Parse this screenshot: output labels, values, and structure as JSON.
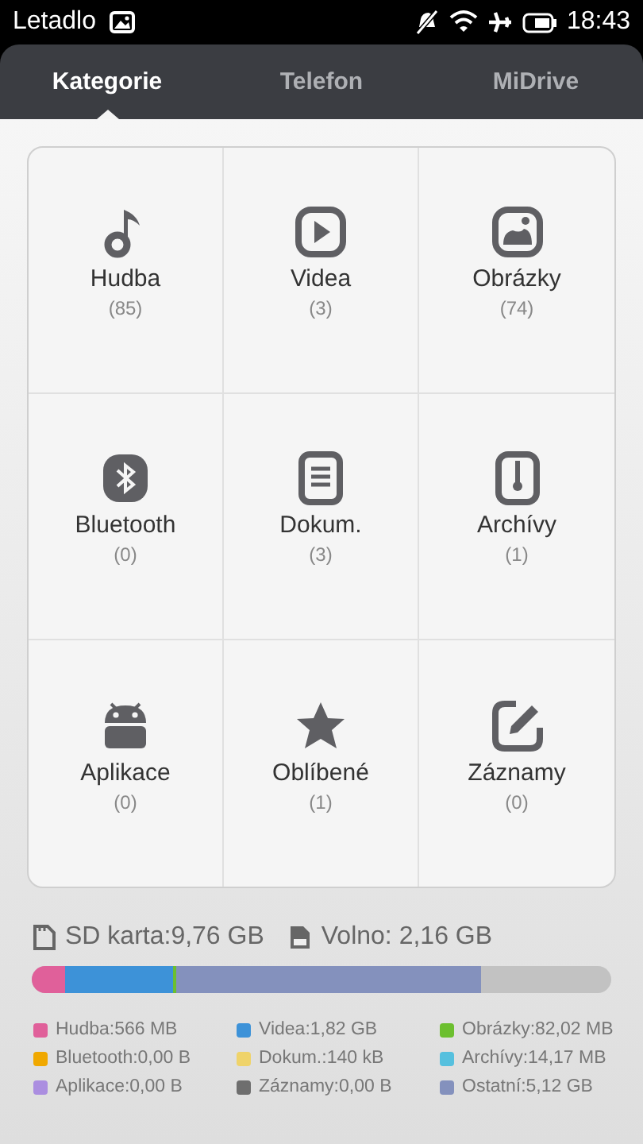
{
  "status_bar": {
    "carrier": "Letadlo",
    "time": "18:43"
  },
  "tabs": [
    {
      "label": "Kategorie",
      "selected": true
    },
    {
      "label": "Telefon",
      "selected": false
    },
    {
      "label": "MiDrive",
      "selected": false
    }
  ],
  "categories": [
    {
      "kind": "music",
      "label": "Hudba",
      "count": "(85)"
    },
    {
      "kind": "video",
      "label": "Videa",
      "count": "(3)"
    },
    {
      "kind": "image",
      "label": "Obrázky",
      "count": "(74)"
    },
    {
      "kind": "bluetooth",
      "label": "Bluetooth",
      "count": "(0)"
    },
    {
      "kind": "document",
      "label": "Dokum.",
      "count": "(3)"
    },
    {
      "kind": "archive",
      "label": "Archívy",
      "count": "(1)"
    },
    {
      "kind": "android",
      "label": "Aplikace",
      "count": "(0)"
    },
    {
      "kind": "star",
      "label": "Oblíbené",
      "count": "(1)"
    },
    {
      "kind": "edit",
      "label": "Záznamy",
      "count": "(0)"
    }
  ],
  "storage": {
    "total": "SD karta:9,76 GB",
    "free": "Volno: 2,16 GB"
  },
  "usage": [
    {
      "label": "Hudba:566 MB",
      "color": "#e0609a"
    },
    {
      "label": "Videa:1,82 GB",
      "color": "#3d92d8"
    },
    {
      "label": "Obrázky:82,02 MB",
      "color": "#6cbf2f"
    },
    {
      "label": "Bluetooth:0,00 B",
      "color": "#f0a800"
    },
    {
      "label": "Dokum.:140 kB",
      "color": "#efd36a"
    },
    {
      "label": "Archívy:14,17 MB",
      "color": "#56c0de"
    },
    {
      "label": "Aplikace:0,00 B",
      "color": "#ab8ee0"
    },
    {
      "label": "Záznamy:0,00 B",
      "color": "#6e6e6e"
    },
    {
      "label": "Ostatní:5,12 GB",
      "color": "#8491bd"
    }
  ]
}
